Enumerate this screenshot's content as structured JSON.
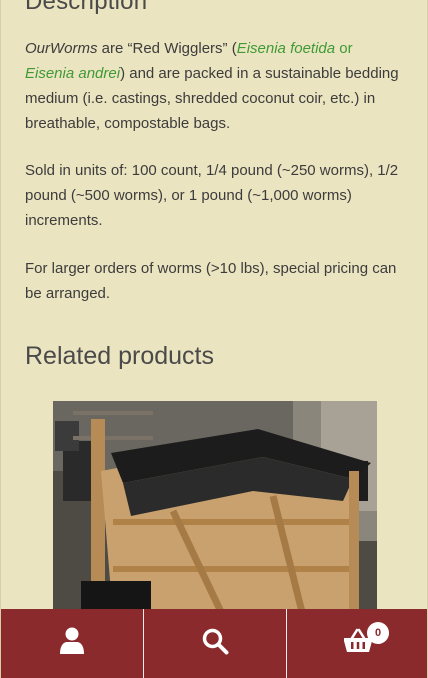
{
  "description": {
    "heading": "Description",
    "p1": {
      "brand": "OurWorms",
      "text_a": " are “Red Wigglers” (",
      "species1": "Eisenia foetida",
      "or": " or ",
      "species2": "Eisenia andrei",
      "text_b": ") and are packed in a sustainable bedding medium (i.e. castings, shredded coconut coir, etc.) in breathable, compostable bags."
    },
    "p2": "Sold in units of: 100 count, 1/4 pound (~250 worms), 1/2 pound (~500 worms), or 1 pound (~1,000 worms) increments.",
    "p3": "For larger orders of worms (>10 lbs), special pricing  can be arranged."
  },
  "related": {
    "heading": "Related products"
  },
  "bottom_bar": {
    "account_icon": "user-icon",
    "search_icon": "search-icon",
    "cart_icon": "basket-icon",
    "cart_count": "0"
  },
  "colors": {
    "background": "#ebe4c0",
    "accent": "#8b2a2d",
    "link": "#3f9a36"
  }
}
